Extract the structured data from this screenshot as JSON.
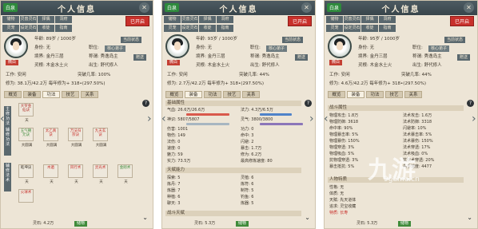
{
  "common": {
    "title": "个人信息",
    "top_tag": "白泉",
    "close": "✕",
    "menu_row1": [
      "储物",
      "灵兽灵石",
      "择偶",
      "洞府"
    ],
    "menu_row2": [
      "灵宠",
      "设定灵石",
      "收徒",
      "指南"
    ],
    "red_button": "已开启",
    "avatar_caption": "微白",
    "current_reg_btn": "当前状态",
    "gift_btn": "赠送",
    "tabs": [
      "概览",
      "装备",
      "功法",
      "技艺",
      "关系"
    ]
  },
  "panel1": {
    "age": "年龄:          89岁 / 1000岁",
    "identity": "身份:   无",
    "rank_label": "职位:",
    "rank_value": "核心弟子",
    "realm": "境界:   金丹三层",
    "title_text": "称谓:   秀逸岛主",
    "lingen": "灵根:   木金水土火",
    "birth": "出生:   舒代修人",
    "job": "工作:   安闲",
    "progress": "突破几率:   100%",
    "cultivation": "修为:     38.1万/42.2万  每年修为+ 318•(297.50%)",
    "skills_title": "功法",
    "skill_categories": [
      "主修功法",
      "辅修功法",
      "辅修法术"
    ],
    "skills": [
      {
        "name": "大罗金仙诀",
        "label": "天"
      },
      {
        "name": "五气朝元诀",
        "label": "大圆满"
      },
      {
        "name": "太乙真诀",
        "label": "大圆满"
      },
      {
        "name": "万法归宗诀",
        "label": "大圆满"
      },
      {
        "name": "九天玄诀",
        "label": "大圆满"
      },
      {
        "name": "乾坤诀",
        "label": "天"
      },
      {
        "name": "木遁",
        "label": "天"
      },
      {
        "name": "风行术",
        "label": "天"
      },
      {
        "name": "灵光术",
        "label": "天"
      },
      {
        "name": "金刚术",
        "label": "天"
      },
      {
        "name": "火球术",
        "label": "天"
      }
    ],
    "footer_label": "灵石: 4.2万",
    "footer_btn": "储物"
  },
  "panel2": {
    "age": "年龄:          93岁 / 1000岁",
    "identity": "身份:   无",
    "rank_label": "职位:",
    "rank_value": "核心弟子",
    "realm": "境界:   金丹三层",
    "title_text": "称谓:   秀逸岛主",
    "lingen": "灵根:   木金水土火",
    "birth": "出生:   舒代修人",
    "job": "工作:   安闲",
    "progress": "突破几率:   44%",
    "cultivation": "修为:     2.7万/42.2万  每年修为+ 318•(297.50%)",
    "section1": "基础属性",
    "stats_left": [
      "气血:   26.6万/26.6万",
      "神识:   5807/5807",
      "伤害:   1001",
      "物伤:   149",
      "法伤:   0",
      "速度:   0",
      "魅力:   59",
      "实力:   73.5万"
    ],
    "stats_right": [
      "法力:   4.3万/6.5万",
      "灵气:   3800/3800",
      "功力:   0",
      "命中:   3",
      "闪避:   2",
      "暴击:   1.7万",
      "修为:   6.2万",
      "最高修炼速度:   80"
    ],
    "section2": "天赋能力",
    "talents_left": [
      "探索:   5",
      "炼丹:   7",
      "炼器:   7",
      "种植:   6",
      "聊天:   3"
    ],
    "talents_right": [
      "灵植:   6",
      "炼符:   6",
      "制符:   5",
      "钓鱼:   6",
      "炼器:   5"
    ],
    "section3": "战斗天赋",
    "footer_label": "灵石: 5.3万",
    "footer_btn": "储物"
  },
  "panel3": {
    "age": "年龄:          95岁 / 1000岁",
    "identity": "身份:   无",
    "rank_label": "职位:",
    "rank_value": "核心弟子",
    "realm": "境界:   金丹三层",
    "title_text": "称谓:   秀逸岛主",
    "lingen": "灵根:   木金水土火",
    "birth": "出生:   舒代修人",
    "job": "工作:   安闲",
    "progress": "突破几率:   44%",
    "cultivation": "修为:     4.6万/42.2万  每年修为+ 318•(297.50%)",
    "section1": "战斗属性",
    "stats_left": [
      "物理攻击:   1.8万",
      "物理防御:   3618",
      "命中率:   90%",
      "物理暴击率:   5%",
      "物理暴伤:   150%",
      "物理穿透:   3%",
      "物理吸血:   5%",
      "抗物理穿透:   3%",
      "暴击抵抗:   5%"
    ],
    "stats_right": [
      "法术攻击:   1.6万",
      "法术防御:   3318",
      "闪避率:   10%",
      "法术暴击率:   5%",
      "法术暴伤:   150%",
      "法术穿透:   17%",
      "法术吸血:   0%",
      "抗法术穿透:   20%",
      "先手速度:   4477"
    ],
    "section2": "人物特质",
    "traits": [
      "性格:   无",
      "体质:   无",
      "天赋:   先天道体",
      "追求:   灵宝收藏",
      "特质:   长寿"
    ],
    "footer_label": "灵石: 5.3万",
    "footer_btn": "储物"
  },
  "watermark": "九游",
  "watermark_sub": "9game.cn"
}
